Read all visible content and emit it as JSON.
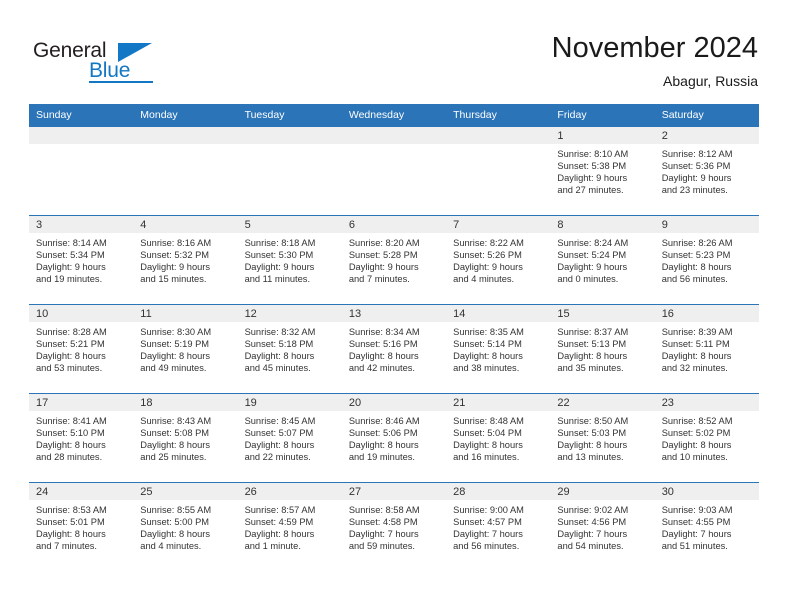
{
  "brand": {
    "name_part1": "General",
    "name_part2": "Blue",
    "logo_icon": "triangle-mark"
  },
  "header": {
    "month_title": "November 2024",
    "location": "Abagur, Russia"
  },
  "colors": {
    "header_blue": "#2b74b8",
    "band_gray": "#efefef",
    "brand_blue": "#1277c4",
    "text": "#333333"
  },
  "calendar": {
    "weekday_headers": [
      "Sunday",
      "Monday",
      "Tuesday",
      "Wednesday",
      "Thursday",
      "Friday",
      "Saturday"
    ],
    "weeks": [
      [
        {
          "day": "",
          "sunrise": "",
          "sunset": "",
          "daylight_line1": "",
          "daylight_line2": "",
          "empty": true
        },
        {
          "day": "",
          "sunrise": "",
          "sunset": "",
          "daylight_line1": "",
          "daylight_line2": "",
          "empty": true
        },
        {
          "day": "",
          "sunrise": "",
          "sunset": "",
          "daylight_line1": "",
          "daylight_line2": "",
          "empty": true
        },
        {
          "day": "",
          "sunrise": "",
          "sunset": "",
          "daylight_line1": "",
          "daylight_line2": "",
          "empty": true
        },
        {
          "day": "",
          "sunrise": "",
          "sunset": "",
          "daylight_line1": "",
          "daylight_line2": "",
          "empty": true
        },
        {
          "day": "1",
          "sunrise": "Sunrise: 8:10 AM",
          "sunset": "Sunset: 5:38 PM",
          "daylight_line1": "Daylight: 9 hours",
          "daylight_line2": "and 27 minutes.",
          "empty": false
        },
        {
          "day": "2",
          "sunrise": "Sunrise: 8:12 AM",
          "sunset": "Sunset: 5:36 PM",
          "daylight_line1": "Daylight: 9 hours",
          "daylight_line2": "and 23 minutes.",
          "empty": false
        }
      ],
      [
        {
          "day": "3",
          "sunrise": "Sunrise: 8:14 AM",
          "sunset": "Sunset: 5:34 PM",
          "daylight_line1": "Daylight: 9 hours",
          "daylight_line2": "and 19 minutes.",
          "empty": false
        },
        {
          "day": "4",
          "sunrise": "Sunrise: 8:16 AM",
          "sunset": "Sunset: 5:32 PM",
          "daylight_line1": "Daylight: 9 hours",
          "daylight_line2": "and 15 minutes.",
          "empty": false
        },
        {
          "day": "5",
          "sunrise": "Sunrise: 8:18 AM",
          "sunset": "Sunset: 5:30 PM",
          "daylight_line1": "Daylight: 9 hours",
          "daylight_line2": "and 11 minutes.",
          "empty": false
        },
        {
          "day": "6",
          "sunrise": "Sunrise: 8:20 AM",
          "sunset": "Sunset: 5:28 PM",
          "daylight_line1": "Daylight: 9 hours",
          "daylight_line2": "and 7 minutes.",
          "empty": false
        },
        {
          "day": "7",
          "sunrise": "Sunrise: 8:22 AM",
          "sunset": "Sunset: 5:26 PM",
          "daylight_line1": "Daylight: 9 hours",
          "daylight_line2": "and 4 minutes.",
          "empty": false
        },
        {
          "day": "8",
          "sunrise": "Sunrise: 8:24 AM",
          "sunset": "Sunset: 5:24 PM",
          "daylight_line1": "Daylight: 9 hours",
          "daylight_line2": "and 0 minutes.",
          "empty": false
        },
        {
          "day": "9",
          "sunrise": "Sunrise: 8:26 AM",
          "sunset": "Sunset: 5:23 PM",
          "daylight_line1": "Daylight: 8 hours",
          "daylight_line2": "and 56 minutes.",
          "empty": false
        }
      ],
      [
        {
          "day": "10",
          "sunrise": "Sunrise: 8:28 AM",
          "sunset": "Sunset: 5:21 PM",
          "daylight_line1": "Daylight: 8 hours",
          "daylight_line2": "and 53 minutes.",
          "empty": false
        },
        {
          "day": "11",
          "sunrise": "Sunrise: 8:30 AM",
          "sunset": "Sunset: 5:19 PM",
          "daylight_line1": "Daylight: 8 hours",
          "daylight_line2": "and 49 minutes.",
          "empty": false
        },
        {
          "day": "12",
          "sunrise": "Sunrise: 8:32 AM",
          "sunset": "Sunset: 5:18 PM",
          "daylight_line1": "Daylight: 8 hours",
          "daylight_line2": "and 45 minutes.",
          "empty": false
        },
        {
          "day": "13",
          "sunrise": "Sunrise: 8:34 AM",
          "sunset": "Sunset: 5:16 PM",
          "daylight_line1": "Daylight: 8 hours",
          "daylight_line2": "and 42 minutes.",
          "empty": false
        },
        {
          "day": "14",
          "sunrise": "Sunrise: 8:35 AM",
          "sunset": "Sunset: 5:14 PM",
          "daylight_line1": "Daylight: 8 hours",
          "daylight_line2": "and 38 minutes.",
          "empty": false
        },
        {
          "day": "15",
          "sunrise": "Sunrise: 8:37 AM",
          "sunset": "Sunset: 5:13 PM",
          "daylight_line1": "Daylight: 8 hours",
          "daylight_line2": "and 35 minutes.",
          "empty": false
        },
        {
          "day": "16",
          "sunrise": "Sunrise: 8:39 AM",
          "sunset": "Sunset: 5:11 PM",
          "daylight_line1": "Daylight: 8 hours",
          "daylight_line2": "and 32 minutes.",
          "empty": false
        }
      ],
      [
        {
          "day": "17",
          "sunrise": "Sunrise: 8:41 AM",
          "sunset": "Sunset: 5:10 PM",
          "daylight_line1": "Daylight: 8 hours",
          "daylight_line2": "and 28 minutes.",
          "empty": false
        },
        {
          "day": "18",
          "sunrise": "Sunrise: 8:43 AM",
          "sunset": "Sunset: 5:08 PM",
          "daylight_line1": "Daylight: 8 hours",
          "daylight_line2": "and 25 minutes.",
          "empty": false
        },
        {
          "day": "19",
          "sunrise": "Sunrise: 8:45 AM",
          "sunset": "Sunset: 5:07 PM",
          "daylight_line1": "Daylight: 8 hours",
          "daylight_line2": "and 22 minutes.",
          "empty": false
        },
        {
          "day": "20",
          "sunrise": "Sunrise: 8:46 AM",
          "sunset": "Sunset: 5:06 PM",
          "daylight_line1": "Daylight: 8 hours",
          "daylight_line2": "and 19 minutes.",
          "empty": false
        },
        {
          "day": "21",
          "sunrise": "Sunrise: 8:48 AM",
          "sunset": "Sunset: 5:04 PM",
          "daylight_line1": "Daylight: 8 hours",
          "daylight_line2": "and 16 minutes.",
          "empty": false
        },
        {
          "day": "22",
          "sunrise": "Sunrise: 8:50 AM",
          "sunset": "Sunset: 5:03 PM",
          "daylight_line1": "Daylight: 8 hours",
          "daylight_line2": "and 13 minutes.",
          "empty": false
        },
        {
          "day": "23",
          "sunrise": "Sunrise: 8:52 AM",
          "sunset": "Sunset: 5:02 PM",
          "daylight_line1": "Daylight: 8 hours",
          "daylight_line2": "and 10 minutes.",
          "empty": false
        }
      ],
      [
        {
          "day": "24",
          "sunrise": "Sunrise: 8:53 AM",
          "sunset": "Sunset: 5:01 PM",
          "daylight_line1": "Daylight: 8 hours",
          "daylight_line2": "and 7 minutes.",
          "empty": false
        },
        {
          "day": "25",
          "sunrise": "Sunrise: 8:55 AM",
          "sunset": "Sunset: 5:00 PM",
          "daylight_line1": "Daylight: 8 hours",
          "daylight_line2": "and 4 minutes.",
          "empty": false
        },
        {
          "day": "26",
          "sunrise": "Sunrise: 8:57 AM",
          "sunset": "Sunset: 4:59 PM",
          "daylight_line1": "Daylight: 8 hours",
          "daylight_line2": "and 1 minute.",
          "empty": false
        },
        {
          "day": "27",
          "sunrise": "Sunrise: 8:58 AM",
          "sunset": "Sunset: 4:58 PM",
          "daylight_line1": "Daylight: 7 hours",
          "daylight_line2": "and 59 minutes.",
          "empty": false
        },
        {
          "day": "28",
          "sunrise": "Sunrise: 9:00 AM",
          "sunset": "Sunset: 4:57 PM",
          "daylight_line1": "Daylight: 7 hours",
          "daylight_line2": "and 56 minutes.",
          "empty": false
        },
        {
          "day": "29",
          "sunrise": "Sunrise: 9:02 AM",
          "sunset": "Sunset: 4:56 PM",
          "daylight_line1": "Daylight: 7 hours",
          "daylight_line2": "and 54 minutes.",
          "empty": false
        },
        {
          "day": "30",
          "sunrise": "Sunrise: 9:03 AM",
          "sunset": "Sunset: 4:55 PM",
          "daylight_line1": "Daylight: 7 hours",
          "daylight_line2": "and 51 minutes.",
          "empty": false
        }
      ]
    ]
  }
}
